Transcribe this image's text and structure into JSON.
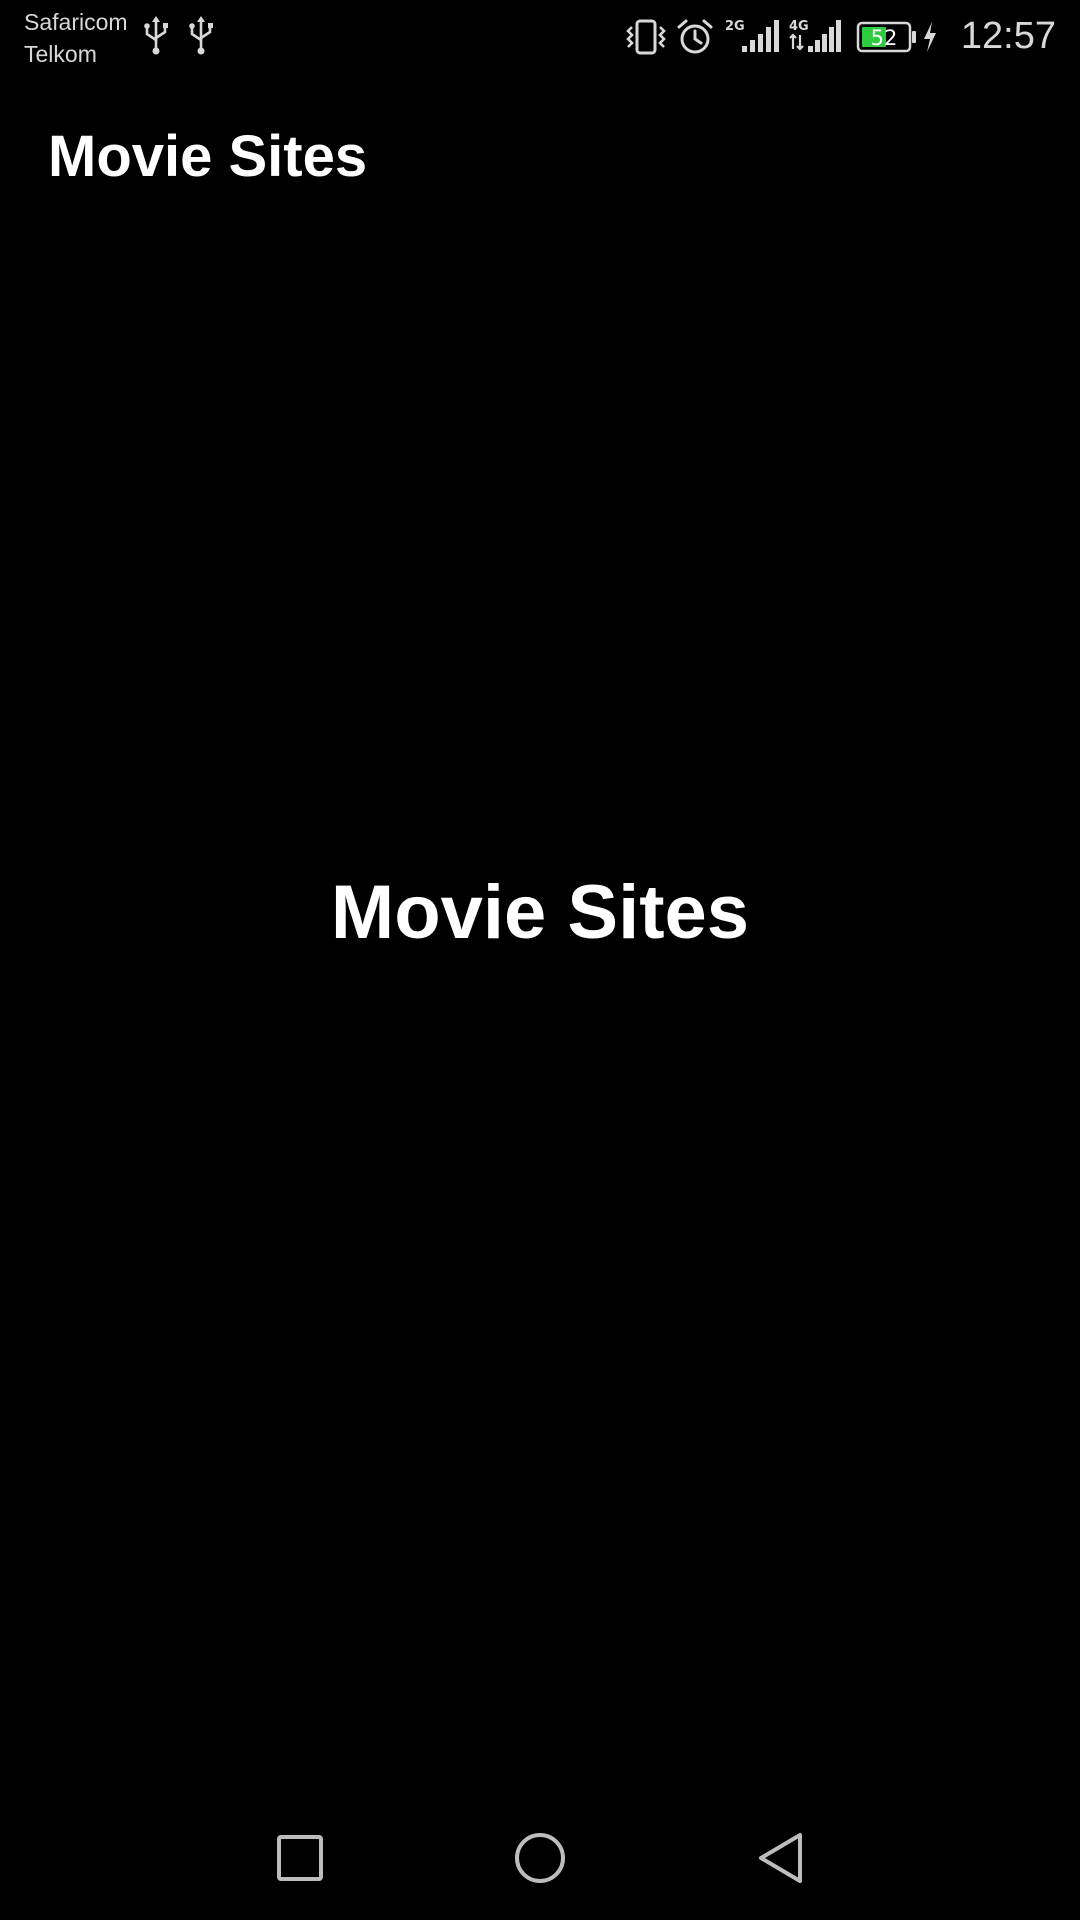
{
  "status_bar": {
    "carrier_1": "Safaricom",
    "carrier_2": "Telkom",
    "battery_level": "52",
    "time": "12:57",
    "network_1": "2G",
    "network_2": "4G",
    "battery_color": "#2ecc40",
    "icons": [
      "usb-icon",
      "usb-icon",
      "vibrate-icon",
      "alarm-icon",
      "signal-2g-icon",
      "signal-4g-icon",
      "battery-icon",
      "charging-icon"
    ]
  },
  "app_bar": {
    "title": "Movie Sites"
  },
  "main": {
    "center_title": "Movie Sites"
  },
  "nav_bar": {
    "icons": [
      "recents-square-icon",
      "home-circle-icon",
      "back-triangle-icon"
    ]
  }
}
